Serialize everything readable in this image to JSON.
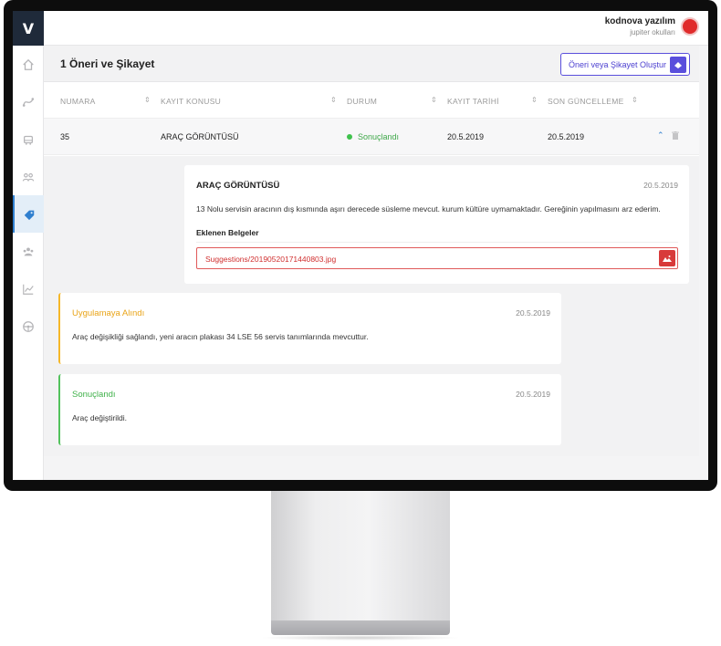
{
  "user": {
    "name": "kodnova yazılım",
    "org": "jupiter okulları"
  },
  "sidebar": {
    "items": [
      {
        "icon": "home-icon"
      },
      {
        "icon": "route-icon"
      },
      {
        "icon": "bus-icon"
      },
      {
        "icon": "people-icon"
      },
      {
        "icon": "tag-icon",
        "active": true
      },
      {
        "icon": "group-icon"
      },
      {
        "icon": "chart-icon"
      },
      {
        "icon": "steering-icon"
      }
    ]
  },
  "page": {
    "title": "1 Öneri ve Şikayet",
    "create_button": "Öneri veya Şikayet Oluştur"
  },
  "table": {
    "headers": [
      "NUMARA",
      "KAYIT KONUSU",
      "DURUM",
      "KAYIT TARİHİ",
      "SON GÜNCELLEME"
    ],
    "rows": [
      {
        "number": "35",
        "subject": "ARAÇ GÖRÜNTÜSÜ",
        "status": "Sonuçlandı",
        "created": "20.5.2019",
        "updated": "20.5.2019"
      }
    ]
  },
  "detail": {
    "title": "ARAÇ GÖRÜNTÜSÜ",
    "date": "20.5.2019",
    "text": "13 Nolu servisin aracının dış kısmında aşırı derecede süsleme mevcut. kurum kültüre uymamaktadır. Gereğinin yapılmasını arz ederim.",
    "docs_label": "Eklenen Belgeler",
    "file": "Suggestions/20190520171440803.jpg"
  },
  "updates": [
    {
      "title": "Uygulamaya Alındı",
      "date": "20.5.2019",
      "text": "Araç değişikliği sağlandı, yeni aracın plakası 34 LSE 56 servis tanımlarında mevcuttur."
    },
    {
      "title": "Sonuçlandı",
      "date": "20.5.2019",
      "text": "Araç değiştirildi."
    }
  ],
  "colors": {
    "accent": "#5a4fdc",
    "status_done": "#3fc24d",
    "status_applied": "#f5b728",
    "file_red": "#d83a3a"
  }
}
